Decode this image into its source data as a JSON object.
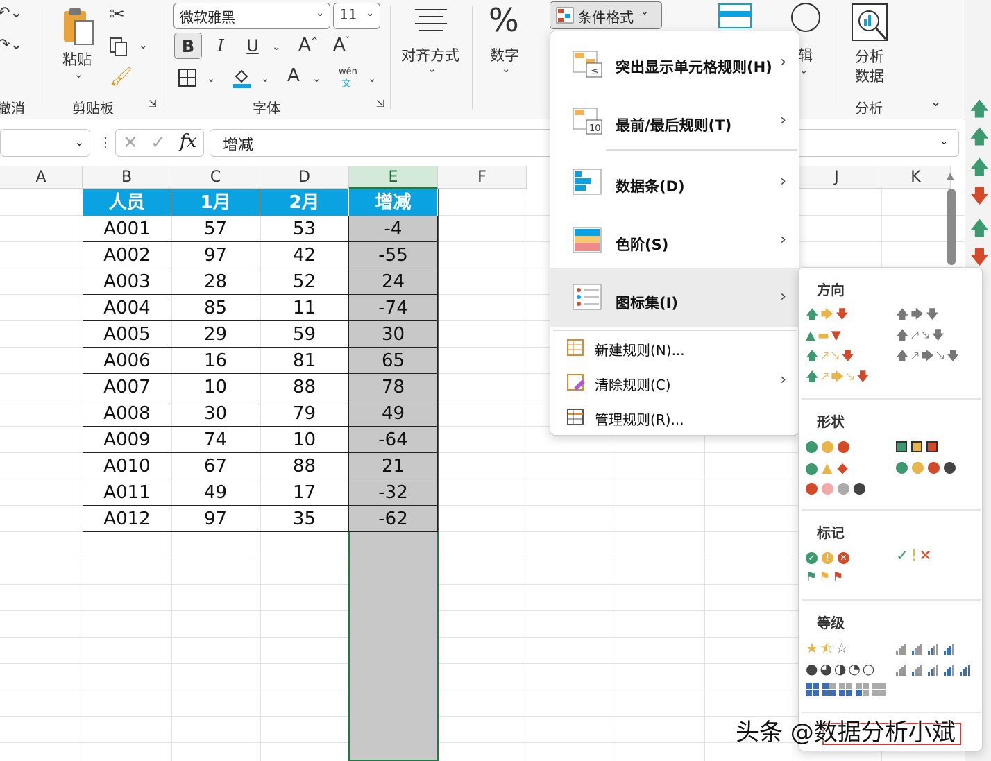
{
  "ribbon": {
    "font_name": "微软雅黑",
    "font_size": "11",
    "groups": {
      "undo": "撤消",
      "clipboard": "剪贴板",
      "font": "字体",
      "analysis": "分析"
    },
    "paste_label": "粘贴",
    "align_label": "对齐方式",
    "number_label": "数字",
    "cond_format_label": "条件格式",
    "edit_label": "辑",
    "analyze_line1": "分析",
    "analyze_line2": "数据",
    "bold": "B",
    "italic": "I",
    "underline": "U",
    "wen": "wén",
    "wen_char": "文"
  },
  "formula_bar": {
    "value": "增减",
    "fx": "fx"
  },
  "columns": [
    "A",
    "B",
    "C",
    "D",
    "E",
    "F",
    "J",
    "K"
  ],
  "table": {
    "headers": [
      "人员",
      "1月",
      "2月",
      "增减"
    ],
    "rows": [
      [
        "A001",
        "57",
        "53",
        "-4"
      ],
      [
        "A002",
        "97",
        "42",
        "-55"
      ],
      [
        "A003",
        "28",
        "52",
        "24"
      ],
      [
        "A004",
        "85",
        "11",
        "-74"
      ],
      [
        "A005",
        "29",
        "59",
        "30"
      ],
      [
        "A006",
        "16",
        "81",
        "65"
      ],
      [
        "A007",
        "10",
        "88",
        "78"
      ],
      [
        "A008",
        "30",
        "79",
        "49"
      ],
      [
        "A009",
        "74",
        "10",
        "-64"
      ],
      [
        "A010",
        "67",
        "88",
        "21"
      ],
      [
        "A011",
        "49",
        "17",
        "-32"
      ],
      [
        "A012",
        "97",
        "35",
        "-62"
      ]
    ]
  },
  "menu": {
    "items": [
      {
        "label": "突出显示单元格规则(H)"
      },
      {
        "label": "最前/最后规则(T)"
      },
      {
        "label": "数据条(D)"
      },
      {
        "label": "色阶(S)"
      },
      {
        "label": "图标集(I)"
      },
      {
        "label": "新建规则(N)..."
      },
      {
        "label": "清除规则(C)"
      },
      {
        "label": "管理规则(R)..."
      }
    ]
  },
  "submenu": {
    "sections": [
      "方向",
      "形状",
      "标记",
      "等级"
    ]
  },
  "watermark": "头条 @数据分析小斌",
  "colors": {
    "header_blue": "#0aa2e0",
    "green": "#3d9970",
    "red": "#d24a2a",
    "yellow": "#e8b54a",
    "selection": "#c8c8c8"
  }
}
